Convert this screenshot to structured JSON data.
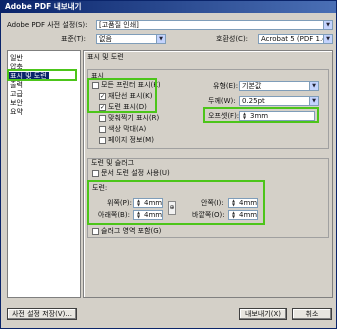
{
  "window": {
    "title": "Adobe PDF 내보내기"
  },
  "top": {
    "preset_label": "Adobe PDF 사전 설정(S):",
    "preset_value": "[고품질 인쇄]",
    "standard_label": "표준(T):",
    "standard_value": "없음",
    "compat_label": "호환성(C):",
    "compat_value": "Acrobat 5 (PDF 1.4)"
  },
  "sidebar": {
    "items": [
      {
        "label": "일반"
      },
      {
        "label": "압축"
      },
      {
        "label": "표시 및 도련"
      },
      {
        "label": "출력"
      },
      {
        "label": "고급"
      },
      {
        "label": "보안"
      },
      {
        "label": "요약"
      }
    ],
    "selected_index": 2
  },
  "main": {
    "section_title": "표시 및 도련",
    "marks": {
      "group_label": "표시",
      "all_marks": "모든 프린터 표시(K)",
      "crop_marks": "재단선 표시(K)",
      "bleed_marks": "도련 표시(D)",
      "registration_marks": "맞춰찍기 표시(R)",
      "color_bars": "색상 막대(A)",
      "page_info": "페이지 정보(M)",
      "type_label": "유형(E):",
      "type_value": "기본값",
      "weight_label": "두께(W):",
      "weight_value": "0.25pt",
      "offset_label": "오프셋(F):",
      "offset_value": "3mm"
    },
    "bleed": {
      "group_label": "도련 및 슬러그",
      "use_doc_bleed": "문서 도련 설정 사용(U)",
      "bleed_label": "도련:",
      "top_label": "위쪽(P):",
      "top_value": "4mm",
      "bottom_label": "아래쪽(B):",
      "bottom_value": "4mm",
      "inside_label": "안쪽(I):",
      "inside_value": "4mm",
      "outside_label": "바깥쪽(O):",
      "outside_value": "4mm",
      "include_slug": "슬러그 영역 포함(G)"
    }
  },
  "footer": {
    "save_preset": "사전 설정 저장(V)...",
    "export": "내보내기(X)",
    "cancel": "취소"
  },
  "colors": {
    "highlight": "#4cc51a",
    "selection": "#0a246a"
  }
}
